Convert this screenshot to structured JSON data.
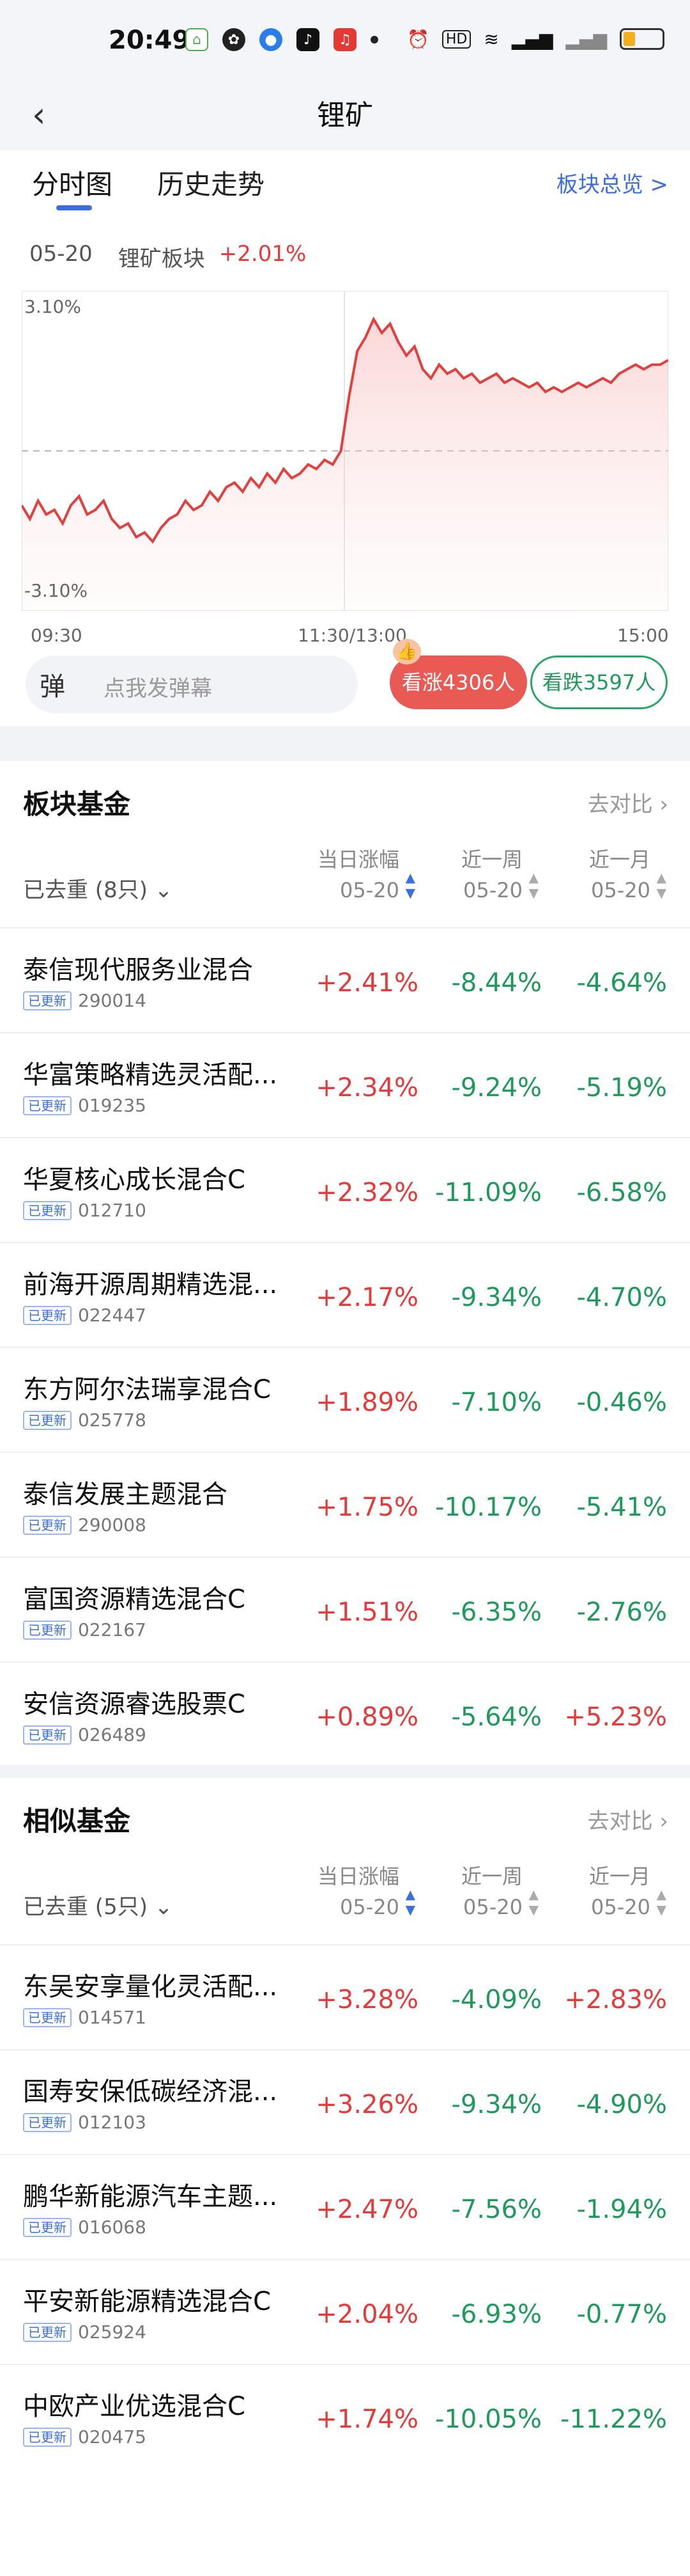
{
  "status_bar": {
    "time": "20:49"
  },
  "header": {
    "back_glyph": "‹",
    "title": "锂矿"
  },
  "chart_section": {
    "tabs": [
      {
        "label": "分时图"
      },
      {
        "label": "历史走势"
      }
    ],
    "overview_link": "板块总览 >",
    "date": "05-20",
    "sector_name": "锂矿板块",
    "sector_change": "+2.01%",
    "danmaku_placeholder": "点我发弹幕",
    "danmaku_icon": "弹",
    "bull_label": "看涨4306人",
    "bear_label": "看跌3597人"
  },
  "chart_data": {
    "type": "area",
    "y_max_label": "3.10%",
    "y_min_label": "-3.10%",
    "ylim": [
      -3.1,
      3.1
    ],
    "x_tick_labels": [
      "09:30",
      "11:30/13:00",
      "15:00"
    ],
    "baseline": 0,
    "values": [
      -1.2,
      -1.5,
      -1.1,
      -1.4,
      -1.3,
      -1.6,
      -1.2,
      -1.0,
      -1.4,
      -1.3,
      -1.1,
      -1.5,
      -1.7,
      -1.6,
      -1.9,
      -1.8,
      -2.0,
      -1.7,
      -1.5,
      -1.4,
      -1.1,
      -1.3,
      -1.2,
      -0.9,
      -1.1,
      -0.8,
      -0.7,
      -0.9,
      -0.6,
      -0.8,
      -0.5,
      -0.7,
      -0.4,
      -0.6,
      -0.5,
      -0.3,
      -0.4,
      -0.2,
      -0.3,
      0.0,
      1.2,
      2.2,
      2.5,
      2.9,
      2.6,
      2.8,
      2.4,
      2.1,
      2.3,
      1.8,
      1.6,
      1.9,
      1.7,
      1.8,
      1.6,
      1.7,
      1.5,
      1.6,
      1.7,
      1.5,
      1.6,
      1.5,
      1.4,
      1.5,
      1.3,
      1.4,
      1.3,
      1.4,
      1.5,
      1.4,
      1.5,
      1.6,
      1.5,
      1.7,
      1.8,
      1.9,
      1.8,
      1.9,
      1.9,
      2.0
    ]
  },
  "sector_funds": {
    "title": "板块基金",
    "compare": "去对比",
    "dedup": "已去重 (8只)",
    "headers": {
      "day": "当日涨幅",
      "day_date": "05-20",
      "week": "近一周",
      "week_date": "05-20",
      "month": "近一月",
      "month_date": "05-20"
    },
    "badge": "已更新",
    "rows": [
      {
        "name": "泰信现代服务业混合",
        "code": "290014",
        "day": "+2.41%",
        "week": "-8.44%",
        "month": "-4.64%"
      },
      {
        "name": "华富策略精选灵活配...",
        "code": "019235",
        "day": "+2.34%",
        "week": "-9.24%",
        "month": "-5.19%"
      },
      {
        "name": "华夏核心成长混合C",
        "code": "012710",
        "day": "+2.32%",
        "week": "-11.09%",
        "month": "-6.58%"
      },
      {
        "name": "前海开源周期精选混...",
        "code": "022447",
        "day": "+2.17%",
        "week": "-9.34%",
        "month": "-4.70%"
      },
      {
        "name": "东方阿尔法瑞享混合C",
        "code": "025778",
        "day": "+1.89%",
        "week": "-7.10%",
        "month": "-0.46%"
      },
      {
        "name": "泰信发展主题混合",
        "code": "290008",
        "day": "+1.75%",
        "week": "-10.17%",
        "month": "-5.41%"
      },
      {
        "name": "富国资源精选混合C",
        "code": "022167",
        "day": "+1.51%",
        "week": "-6.35%",
        "month": "-2.76%"
      },
      {
        "name": "安信资源睿选股票C",
        "code": "026489",
        "day": "+0.89%",
        "week": "-5.64%",
        "month": "+5.23%"
      }
    ]
  },
  "similar_funds": {
    "title": "相似基金",
    "compare": "去对比",
    "dedup": "已去重 (5只)",
    "headers": {
      "day": "当日涨幅",
      "day_date": "05-20",
      "week": "近一周",
      "week_date": "05-20",
      "month": "近一月",
      "month_date": "05-20"
    },
    "badge": "已更新",
    "rows": [
      {
        "name": "东吴安享量化灵活配...",
        "code": "014571",
        "day": "+3.28%",
        "week": "-4.09%",
        "month": "+2.83%"
      },
      {
        "name": "国寿安保低碳经济混...",
        "code": "012103",
        "day": "+3.26%",
        "week": "-9.34%",
        "month": "-4.90%"
      },
      {
        "name": "鹏华新能源汽车主题...",
        "code": "016068",
        "day": "+2.47%",
        "week": "-7.56%",
        "month": "-1.94%"
      },
      {
        "name": "平安新能源精选混合C",
        "code": "025924",
        "day": "+2.04%",
        "week": "-6.93%",
        "month": "-0.77%"
      },
      {
        "name": "中欧产业优选混合C",
        "code": "020475",
        "day": "+1.74%",
        "week": "-10.05%",
        "month": "-11.22%"
      }
    ]
  },
  "colors": {
    "up": "#e63a3a",
    "down": "#1f9a5c",
    "accent": "#3b6fe0"
  }
}
